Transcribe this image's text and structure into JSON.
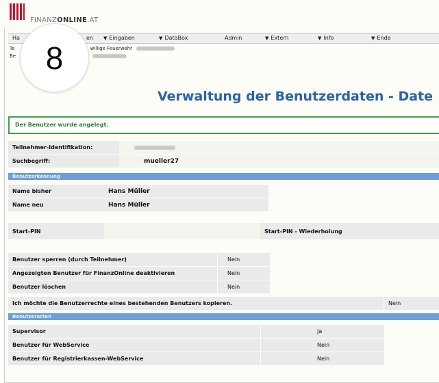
{
  "logo": {
    "brand_a": "FINANZ",
    "brand_b": "ONLINE",
    "brand_c": ".AT"
  },
  "menu": {
    "items": [
      "Ha",
      "en",
      "Eingaben",
      "DataBox",
      "Admin",
      "Extern",
      "Info",
      "Ende"
    ]
  },
  "info_line_1": {
    "prefix": "Te",
    "text": "willige Feuerwehr"
  },
  "info_line_2": {
    "prefix": "Be"
  },
  "step_badge": "8",
  "page_title": "Verwaltung der Benutzerdaten - Date",
  "notice": "Der Benutzer wurde angelegt.",
  "fields": {
    "teilnehmer_label": "Teilnehmer-Identifikation:",
    "suchbegriff_label": "Suchbegriff:",
    "suchbegriff_value": "mueller27"
  },
  "section_benutzerkennung": "Benutzerkennung",
  "name_bisher_label": "Name bisher",
  "name_bisher_value": "Hans Müller",
  "name_neu_label": "Name neu",
  "name_neu_value": "Hans Müller",
  "start_pin_label": "Start-PIN",
  "start_pin_repeat_label": "Start-PIN - Wiederholung",
  "options": [
    {
      "label": "Benutzer sperren (durch Teilnehmer)",
      "value": "Nein"
    },
    {
      "label": "Angezeigten Benutzer für FinanzOnline deaktivieren",
      "value": "Nein"
    },
    {
      "label": "Benutzer löschen",
      "value": "Nein"
    }
  ],
  "copy_rights_label": "Ich möchte die Benutzerrechte eines bestehenden Benutzers kopieren.",
  "copy_rights_value": "Nein",
  "section_benutzerarten": "Benutzerarten",
  "user_types": [
    {
      "label": "Supervisor",
      "value": "Ja"
    },
    {
      "label": "Benutzer für WebService",
      "value": "Nein"
    },
    {
      "label": "Benutzer für Registrierkassen-WebService",
      "value": "Nein"
    }
  ]
}
